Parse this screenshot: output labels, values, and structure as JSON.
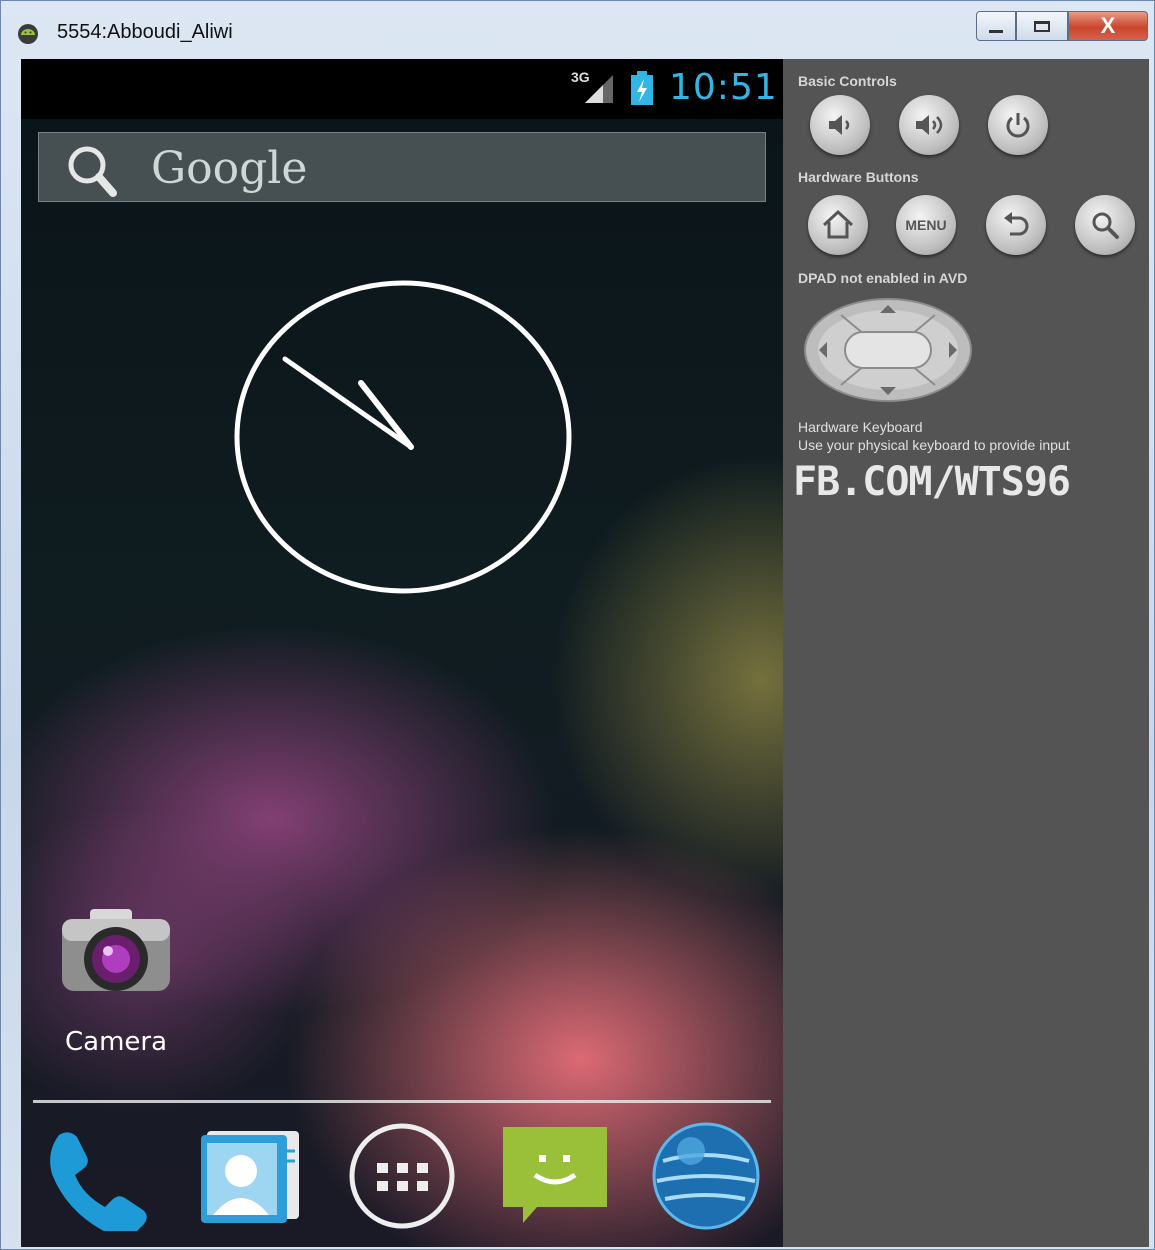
{
  "window": {
    "title": "5554:Abboudi_Aliwi",
    "buttons": {
      "minimize": "minimize",
      "maximize": "maximize",
      "close": "X"
    }
  },
  "statusbar": {
    "network": "3G",
    "time": "10:51"
  },
  "search": {
    "label": "Google"
  },
  "home": {
    "apps": [
      {
        "label": "Camera",
        "icon": "camera-icon"
      }
    ],
    "dock": [
      {
        "icon": "phone-icon"
      },
      {
        "icon": "contacts-icon"
      },
      {
        "icon": "app-drawer-icon"
      },
      {
        "icon": "messaging-icon"
      },
      {
        "icon": "browser-icon"
      }
    ]
  },
  "panel": {
    "basic_controls_label": "Basic Controls",
    "hardware_buttons_label": "Hardware Buttons",
    "menu_label": "MENU",
    "dpad_label": "DPAD not enabled in AVD",
    "keyboard_title": "Hardware Keyboard",
    "keyboard_hint": "Use your physical keyboard to provide input",
    "watermark": "FB.COM/WTS96"
  },
  "colors": {
    "clock_accent": "#33b5e5",
    "panel_bg": "#545454"
  }
}
